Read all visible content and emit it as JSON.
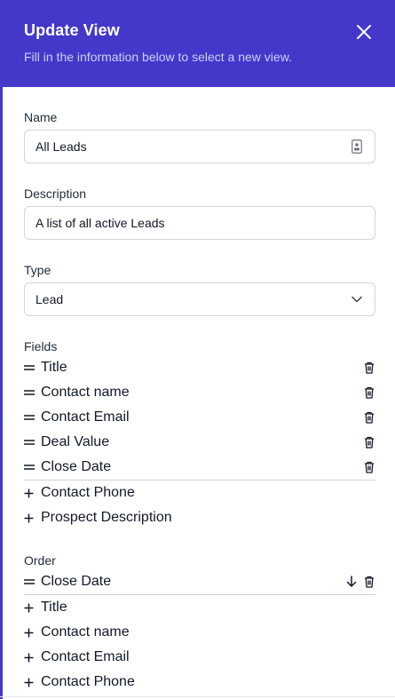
{
  "header": {
    "title": "Update View",
    "subtitle": "Fill in the information below to select a new view."
  },
  "form": {
    "name": {
      "label": "Name",
      "value": "All Leads"
    },
    "description": {
      "label": "Description",
      "value": "A list of all active Leads"
    },
    "type": {
      "label": "Type",
      "value": "Lead"
    }
  },
  "fields": {
    "label": "Fields",
    "selected": [
      "Title",
      "Contact name",
      "Contact Email",
      "Deal Value",
      "Close Date"
    ],
    "available": [
      "Contact Phone",
      "Prospect Description"
    ]
  },
  "order": {
    "label": "Order",
    "selected": [
      "Close Date"
    ],
    "available": [
      "Title",
      "Contact name",
      "Contact Email",
      "Contact Phone"
    ]
  },
  "icons": {
    "close": "close-icon",
    "contact_card": "contact-card-icon",
    "chevron": "chevron-down-icon",
    "drag": "drag-handle-icon",
    "delete": "trash-icon",
    "add": "plus-icon",
    "sort": "arrow-down-icon"
  },
  "colors": {
    "accent": "#4338ca",
    "subtitle": "#c7d2fe",
    "border": "#d1d5db"
  }
}
